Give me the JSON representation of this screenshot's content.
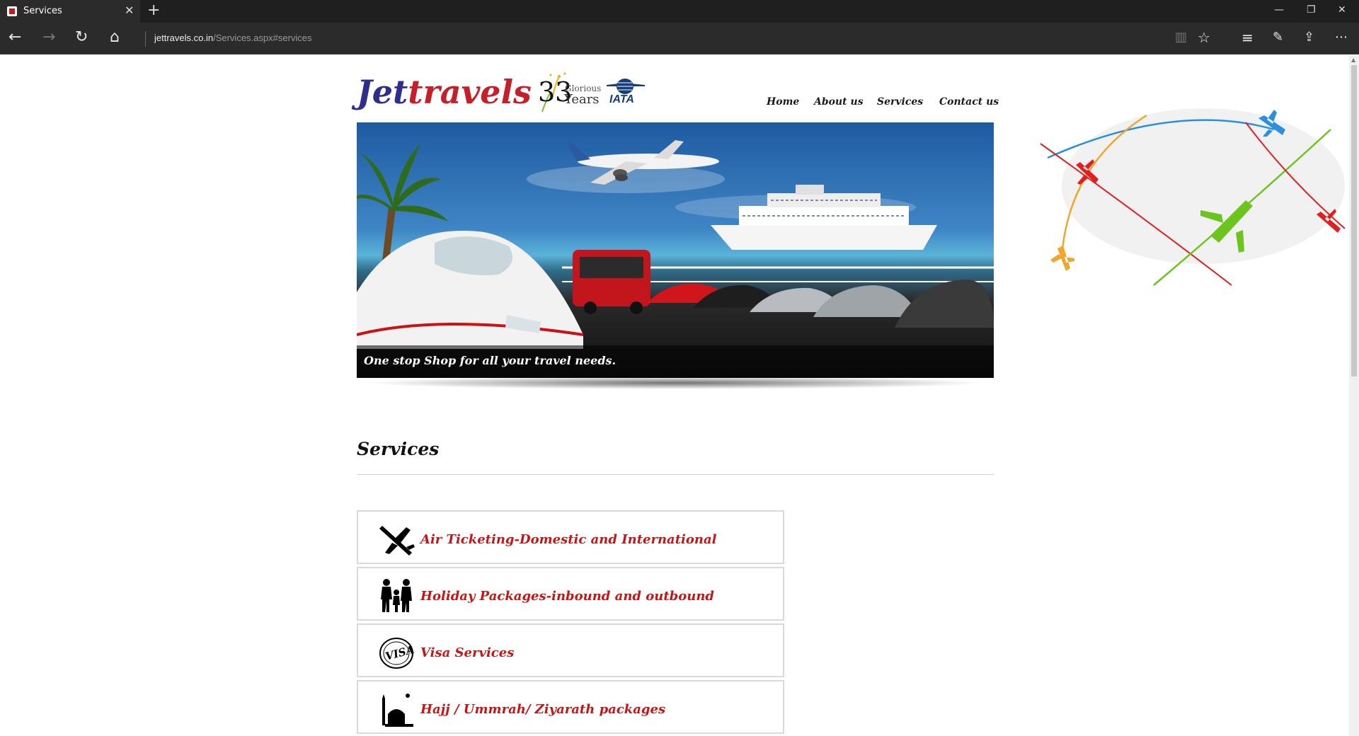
{
  "browser": {
    "tab_title": "Services",
    "url_domain": "jettravels.co.in",
    "url_path": "/Services.aspx#services"
  },
  "site": {
    "logo_prefix": "Jet",
    "logo_suffix": "travels",
    "badge_number": "33",
    "badge_glorious": "Glorious",
    "badge_years": "Years",
    "iata_label": "IATA"
  },
  "nav": {
    "home": "Home",
    "about": "About us",
    "services": "Services",
    "contact": "Contact us"
  },
  "hero": {
    "caption": "One stop Shop for all your travel needs."
  },
  "services": {
    "title": "Services",
    "items": [
      {
        "label": "Air Ticketing-Domestic and International",
        "icon": "airplane-icon"
      },
      {
        "label": "Holiday Packages-inbound and outbound",
        "icon": "family-icon"
      },
      {
        "label": "Visa Services",
        "icon": "visa-stamp-icon"
      },
      {
        "label": "Hajj / Ummrah/ Ziyarath packages",
        "icon": "mosque-icon"
      }
    ]
  },
  "colors": {
    "brand_blue": "#2e2f8a",
    "brand_red": "#c51f2a",
    "service_red": "#c81414"
  }
}
